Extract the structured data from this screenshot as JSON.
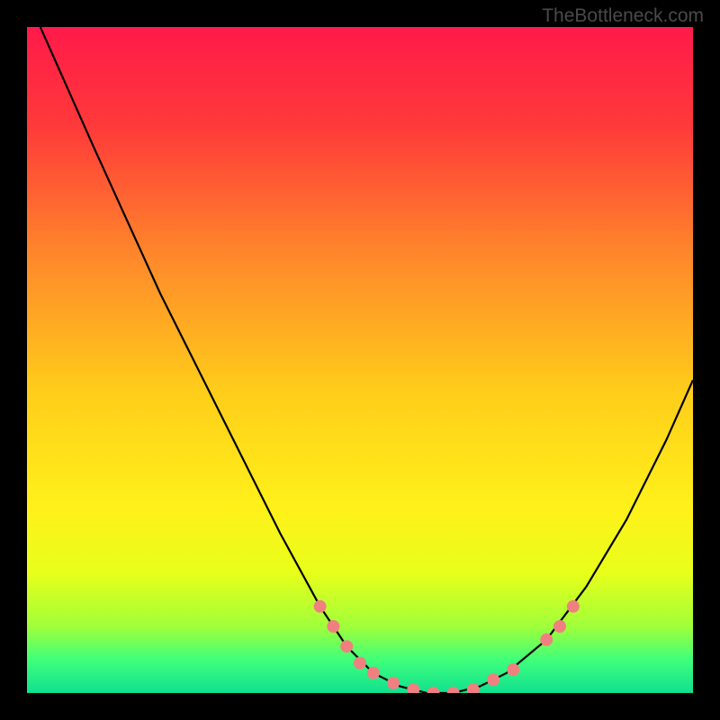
{
  "watermark": "TheBottleneck.com",
  "chart_data": {
    "type": "line",
    "title": "",
    "xlabel": "",
    "ylabel": "",
    "xlim": [
      0,
      100
    ],
    "ylim": [
      0,
      100
    ],
    "curve": {
      "name": "bottleneck-curve",
      "points": [
        {
          "x": 2,
          "y": 100
        },
        {
          "x": 10,
          "y": 82
        },
        {
          "x": 20,
          "y": 60
        },
        {
          "x": 30,
          "y": 40
        },
        {
          "x": 38,
          "y": 24
        },
        {
          "x": 44,
          "y": 13
        },
        {
          "x": 48,
          "y": 7
        },
        {
          "x": 52,
          "y": 3
        },
        {
          "x": 56,
          "y": 1
        },
        {
          "x": 60,
          "y": 0
        },
        {
          "x": 64,
          "y": 0
        },
        {
          "x": 68,
          "y": 1
        },
        {
          "x": 72,
          "y": 3
        },
        {
          "x": 78,
          "y": 8
        },
        {
          "x": 84,
          "y": 16
        },
        {
          "x": 90,
          "y": 26
        },
        {
          "x": 96,
          "y": 38
        },
        {
          "x": 100,
          "y": 47
        }
      ]
    },
    "markers": {
      "name": "optimal-zone-markers",
      "color": "#f08080",
      "points": [
        {
          "x": 44,
          "y": 13
        },
        {
          "x": 46,
          "y": 10
        },
        {
          "x": 48,
          "y": 7
        },
        {
          "x": 50,
          "y": 4.5
        },
        {
          "x": 52,
          "y": 3
        },
        {
          "x": 55,
          "y": 1.5
        },
        {
          "x": 58,
          "y": 0.5
        },
        {
          "x": 61,
          "y": 0
        },
        {
          "x": 64,
          "y": 0
        },
        {
          "x": 67,
          "y": 0.5
        },
        {
          "x": 70,
          "y": 2
        },
        {
          "x": 73,
          "y": 3.5
        },
        {
          "x": 78,
          "y": 8
        },
        {
          "x": 80,
          "y": 10
        },
        {
          "x": 82,
          "y": 13
        }
      ]
    },
    "gradient_stops": [
      {
        "offset": 0,
        "color": "#ff1a4a"
      },
      {
        "offset": 15,
        "color": "#ff3a3a"
      },
      {
        "offset": 35,
        "color": "#ff8a2a"
      },
      {
        "offset": 55,
        "color": "#ffce1a"
      },
      {
        "offset": 72,
        "color": "#fff01a"
      },
      {
        "offset": 82,
        "color": "#e8ff1a"
      },
      {
        "offset": 90,
        "color": "#a0ff3a"
      },
      {
        "offset": 95,
        "color": "#40ff7a"
      },
      {
        "offset": 100,
        "color": "#10e090"
      }
    ]
  }
}
